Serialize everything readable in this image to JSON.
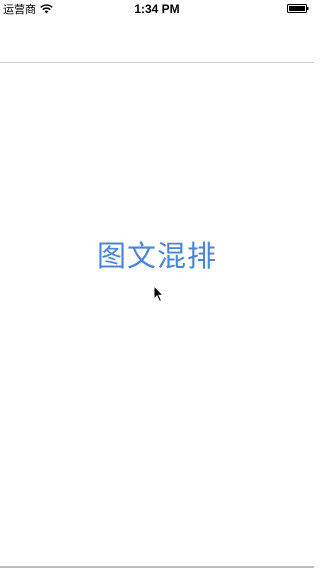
{
  "status_bar": {
    "carrier": "运营商",
    "time": "1:34 PM",
    "wifi_icon": "wifi-icon",
    "battery_icon": "battery-full-icon"
  },
  "nav_bar": {
    "title": ""
  },
  "main": {
    "link_label": "图文混排",
    "link_color": "#4a86d8"
  },
  "cursor": {
    "icon": "mouse-pointer-icon"
  }
}
